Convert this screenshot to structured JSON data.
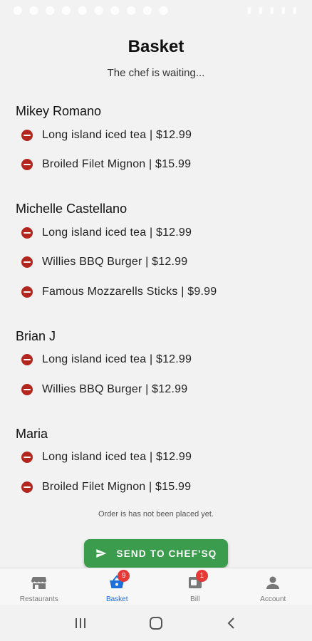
{
  "header": {
    "title": "Basket",
    "subtitle": "The chef is waiting..."
  },
  "groups": [
    {
      "name": "Mikey Romano",
      "items": [
        "Long island iced tea | $12.99",
        "Broiled Filet Mignon | $15.99"
      ]
    },
    {
      "name": "Michelle Castellano",
      "items": [
        "Long island iced tea | $12.99",
        "Willies BBQ Burger | $12.99",
        "Famous Mozzarells Sticks | $9.99"
      ]
    },
    {
      "name": "Brian J",
      "items": [
        "Long island iced tea | $12.99",
        "Willies BBQ Burger | $12.99"
      ]
    },
    {
      "name": "Maria",
      "items": [
        "Long island iced tea | $12.99",
        "Broiled Filet Mignon | $15.99"
      ]
    }
  ],
  "order_note": "Order is has not been placed yet.",
  "send_button_label": "SEND TO CHEF'SQ",
  "bottom_nav": [
    {
      "label": "Restaurants",
      "icon": "storefront-icon",
      "active": false,
      "badge": ""
    },
    {
      "label": "Basket",
      "icon": "basket-icon",
      "active": true,
      "badge": "9"
    },
    {
      "label": "Bill",
      "icon": "bill-icon",
      "active": false,
      "badge": "1"
    },
    {
      "label": "Account",
      "icon": "person-icon",
      "active": false,
      "badge": ""
    }
  ],
  "colors": {
    "accent": "#1e6fd9",
    "send_button": "#3a9c4c",
    "remove_icon": "#b3261e",
    "badge": "#e53935",
    "background": "#f2f2f2"
  }
}
